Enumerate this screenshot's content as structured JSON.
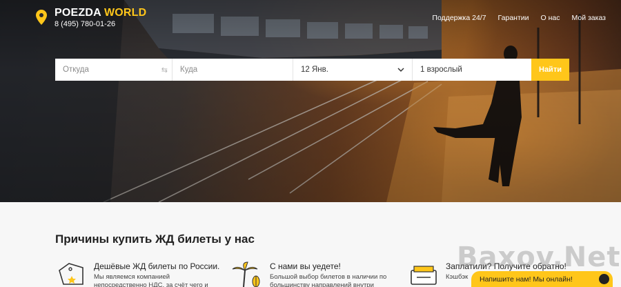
{
  "header": {
    "logo_primary": "POEZDA",
    "logo_accent": "WORLD",
    "phone": "8 (495) 780-01-26",
    "nav": [
      "Поддержка 24/7",
      "Гарантии",
      "О нас",
      "Мой заказ"
    ]
  },
  "search": {
    "from_placeholder": "Откуда",
    "to_placeholder": "Куда",
    "date": "12 Янв.",
    "passengers": "1 взрослый",
    "submit_label": "Найти"
  },
  "colors": {
    "accent": "#ffc61a"
  },
  "content": {
    "section_title": "Причины купить ЖД билеты у нас",
    "features": [
      {
        "icon": "ticket-tag-icon",
        "title": "Дешёвые ЖД билеты по России.",
        "desc": "Мы являемся компанией непосредственно НДС, за счёт чего и"
      },
      {
        "icon": "palm-tree-icon",
        "title": "С нами вы уедете!",
        "desc": "Большой выбор билетов в наличии по большинству направлений внутри"
      },
      {
        "icon": "cashback-icon",
        "title": "Заплатили? Получите обратно!",
        "desc": "Кэшбэк"
      }
    ]
  },
  "watermark": "Baxov.Net",
  "chat": {
    "label": "Напишите нам! Мы онлайн!"
  }
}
